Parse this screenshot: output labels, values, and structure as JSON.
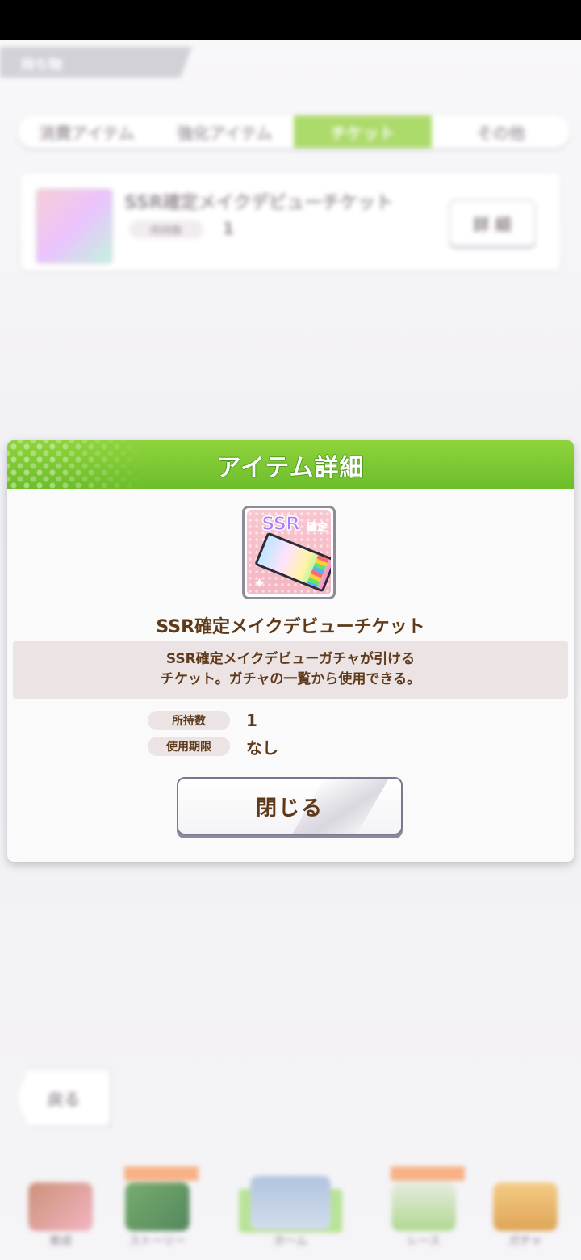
{
  "background": {
    "screen_title": "持ち物",
    "tabs": [
      {
        "label": "消費アイテム",
        "active": false
      },
      {
        "label": "強化アイテム",
        "active": false
      },
      {
        "label": "チケット",
        "active": true
      },
      {
        "label": "その他",
        "active": false
      }
    ],
    "item": {
      "name": "SSR確定メイクデビューチケット",
      "owned_badge": "所持数",
      "qty": "1",
      "detail_button": "詳 細"
    },
    "back_button": "戻る",
    "nav": [
      {
        "label": "育成",
        "icon": "trainee-icon"
      },
      {
        "label": "ストーリー",
        "icon": "story-book-icon"
      },
      {
        "label": "ホーム",
        "icon": "home-building-icon"
      },
      {
        "label": "レース",
        "icon": "race-icon"
      },
      {
        "label": "ガチャ",
        "icon": "gacha-icon"
      }
    ]
  },
  "dialog": {
    "title": "アイテム詳細",
    "icon": {
      "name": "ssr-ticket-icon",
      "ssr_text": "SSR",
      "kakutei_text": "確定"
    },
    "item_name": "SSR確定メイクデビューチケット",
    "description_lines": [
      "SSR確定メイクデビューガチャが引ける",
      "チケット。ガチャの一覧から使用できる。"
    ],
    "stats": [
      {
        "label": "所持数",
        "value": "1"
      },
      {
        "label": "使用期限",
        "value": "なし"
      }
    ],
    "close_button": "閉じる"
  },
  "colors": {
    "header_green": "#7ccb33",
    "text_brown": "#5e3a1a",
    "desc_bg": "#ece4e4"
  }
}
